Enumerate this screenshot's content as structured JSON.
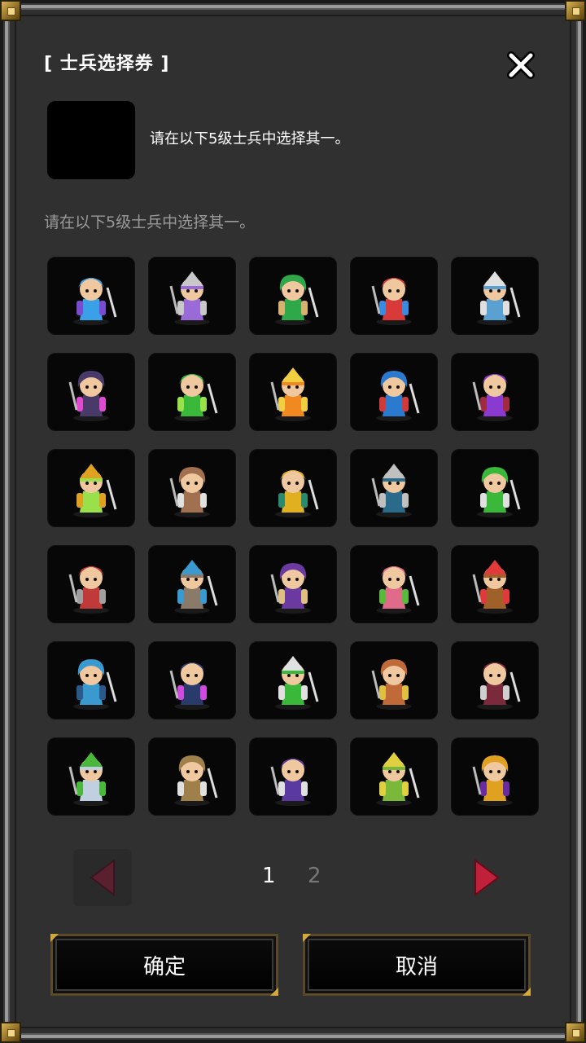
{
  "dialog": {
    "title": "[ 士兵选择券 ]",
    "item_description": "请在以下5级士兵中选择其一。",
    "hint": "请在以下5级士兵中选择其一。"
  },
  "icons": {
    "close": "close-icon",
    "prev": "triangle-left-icon",
    "next": "triangle-right-icon"
  },
  "soldiers": [
    {
      "color": "#3aa0e8",
      "accent": "#7a4ad0"
    },
    {
      "color": "#9a6ad8",
      "accent": "#c8c8c8"
    },
    {
      "color": "#2fa84a",
      "accent": "#d8b070"
    },
    {
      "color": "#d83a3a",
      "accent": "#3a8ae0"
    },
    {
      "color": "#5aa0d0",
      "accent": "#e0e0e0"
    },
    {
      "color": "#4a3a6a",
      "accent": "#e04ad0"
    },
    {
      "color": "#3ab83a",
      "accent": "#9ae04a"
    },
    {
      "color": "#f08a20",
      "accent": "#f0d040"
    },
    {
      "color": "#2a7ad0",
      "accent": "#d03a3a"
    },
    {
      "color": "#8a3ad0",
      "accent": "#a02a40"
    },
    {
      "color": "#9ae04a",
      "accent": "#e0a020"
    },
    {
      "color": "#a07050",
      "accent": "#e0e0e0"
    },
    {
      "color": "#e0b020",
      "accent": "#2a8a70"
    },
    {
      "color": "#2a6a8a",
      "accent": "#c0c0c0"
    },
    {
      "color": "#3ab83a",
      "accent": "#e0e0e0"
    },
    {
      "color": "#c03a3a",
      "accent": "#a0a0a0"
    },
    {
      "color": "#8a7a6a",
      "accent": "#3a9ad0"
    },
    {
      "color": "#6a3aa0",
      "accent": "#e0c080"
    },
    {
      "color": "#e06a8a",
      "accent": "#5ab83a"
    },
    {
      "color": "#a0602a",
      "accent": "#e03a3a"
    },
    {
      "color": "#3a9ad0",
      "accent": "#2a5a8a"
    },
    {
      "color": "#2a3a6a",
      "accent": "#d04ae0"
    },
    {
      "color": "#3ab83a",
      "accent": "#e0e0e0"
    },
    {
      "color": "#c06a3a",
      "accent": "#e0c040"
    },
    {
      "color": "#7a2a3a",
      "accent": "#d0d0d0"
    },
    {
      "color": "#c0d0e0",
      "accent": "#4ab83a"
    },
    {
      "color": "#a0804a",
      "accent": "#e0e0e0"
    },
    {
      "color": "#5a3aa0",
      "accent": "#e0e0e0"
    },
    {
      "color": "#7ab83a",
      "accent": "#e0d040"
    },
    {
      "color": "#e0a020",
      "accent": "#6a2aa0"
    }
  ],
  "pagination": {
    "page1": "1",
    "page2": "2",
    "current": 1
  },
  "buttons": {
    "confirm": "确定",
    "cancel": "取消"
  },
  "colors": {
    "background": "#303030",
    "arrow_active": "#c0203a",
    "arrow_disabled": "#5a2030",
    "gold": "#d4a93c"
  }
}
